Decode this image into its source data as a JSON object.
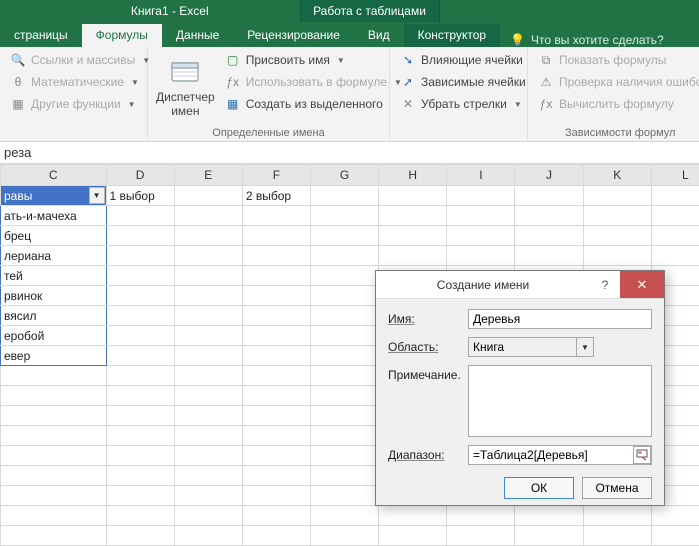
{
  "title": {
    "doc": "Книга1 - Excel",
    "tool_context": "Работа с таблицами"
  },
  "tabs": {
    "t0": "страницы",
    "t1": "Формулы",
    "t2": "Данные",
    "t3": "Рецензирование",
    "t4": "Вид",
    "t5": "Конструктор",
    "tell_me": "Что вы хотите сделать?"
  },
  "ribbon": {
    "g1": {
      "b0": "Ссылки и массивы",
      "b1": "Математические",
      "b2": "Другие функции"
    },
    "g2": {
      "big": "Диспетчер имен",
      "b0": "Присвоить имя",
      "b1": "Использовать в формуле",
      "b2": "Создать из выделенного",
      "label": "Определенные имена"
    },
    "g3": {
      "b0": "Влияющие ячейки",
      "b1": "Зависимые ячейки",
      "b2": "Убрать стрелки"
    },
    "g4": {
      "b0": "Показать формулы",
      "b1": "Проверка наличия ошибо",
      "b2": "Вычислить формулу",
      "label": "Зависимости формул"
    }
  },
  "formula_bar": "реза",
  "columns": [
    "C",
    "D",
    "E",
    "F",
    "G",
    "H",
    "I",
    "J",
    "K",
    "L"
  ],
  "table": {
    "header": "равы",
    "rows": [
      "ать-и-мачеха",
      "брец",
      "лериана",
      "тей",
      "рвинок",
      "вясил",
      "еробой",
      "евер"
    ]
  },
  "cells": {
    "d1": "1 выбор",
    "f1": "2 выбор"
  },
  "dialog": {
    "title": "Создание имени",
    "l_name": "Имя:",
    "l_scope": "Область:",
    "l_comment": "Примечание.",
    "l_range": "Диапазон:",
    "v_name": "Деревья",
    "v_scope": "Книга",
    "v_comment": "",
    "v_range": "=Таблица2[Деревья]",
    "ok": "ОК",
    "cancel": "Отмена"
  }
}
